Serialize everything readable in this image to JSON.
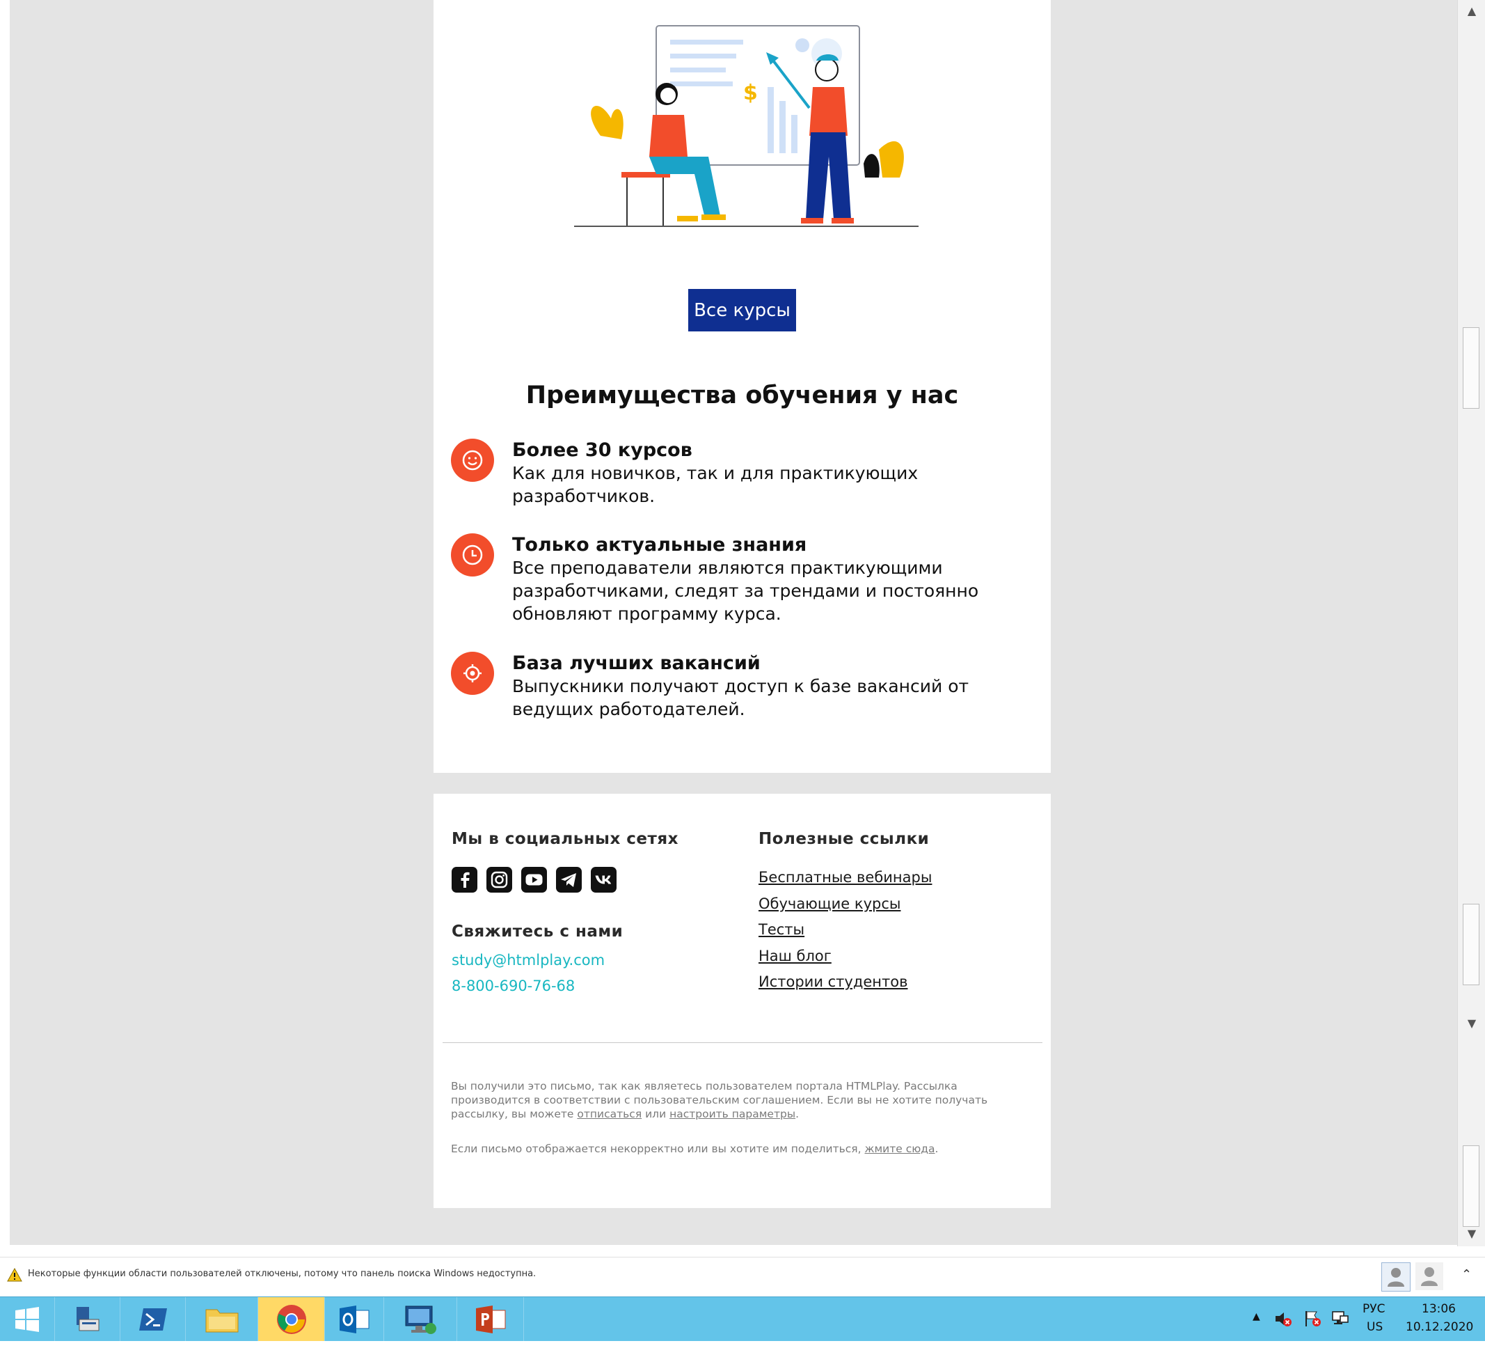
{
  "email": {
    "cta_button": "Все курсы",
    "advantages_title": "Преимущества обучения у нас",
    "advantages": [
      {
        "title": "Более 30 курсов",
        "text": "Как для новичков, так и для практикующих разработчиков.",
        "icon": "smile-icon"
      },
      {
        "title": "Только актуальные знания",
        "text": "Все преподаватели являются практикующими разработчиками, следят за трендами и постоянно обновляют программу курса.",
        "icon": "clock-icon"
      },
      {
        "title": "База лучших вакансий",
        "text": "Выпускники получают доступ к базе вакансий от ведущих работодателей.",
        "icon": "target-icon"
      }
    ],
    "footer": {
      "social_heading": "Мы в социальных сетях",
      "social_icons": [
        "facebook-icon",
        "instagram-icon",
        "youtube-icon",
        "telegram-icon",
        "vk-icon"
      ],
      "contact_heading": "Свяжитесь с нами",
      "email": "study@htmlplay.com",
      "phone": "8-800-690-76-68",
      "links_heading": "Полезные ссылки",
      "links": [
        "Бесплатные вебинары",
        "Обучающие курсы",
        "Тесты",
        "Наш блог",
        "Истории студентов"
      ],
      "fine_1a": "Вы получили это письмо, так как являетесь пользователем портала HTMLPlay. Рассылка производится в соответствии с пользовательским соглашением. Если вы не хотите получать рассылку, вы можете ",
      "unsubscribe": "отписаться",
      "fine_1b": " или ",
      "settings": "настроить параметры",
      "fine_1c": ".",
      "fine_2a": "Если письмо отображается некорректно или вы хотите им поделиться, ",
      "click_here": "жмите сюда",
      "fine_2b": "."
    }
  },
  "notification": {
    "text": "Некоторые функции области пользователей отключены, потому что панель поиска Windows недоступна."
  },
  "taskbar": {
    "apps": [
      "windows-start",
      "server-manager",
      "powershell",
      "file-explorer",
      "chrome",
      "outlook",
      "remote-desktop",
      "powerpoint"
    ],
    "active_app": "chrome",
    "language": "РУС",
    "layout": "US",
    "time": "13:06",
    "date": "10.12.2020"
  },
  "colors": {
    "brand_blue": "#0f2f91",
    "accent_red": "#f24d2b",
    "link_teal": "#18b7c1",
    "taskbar": "#63c4e9"
  }
}
